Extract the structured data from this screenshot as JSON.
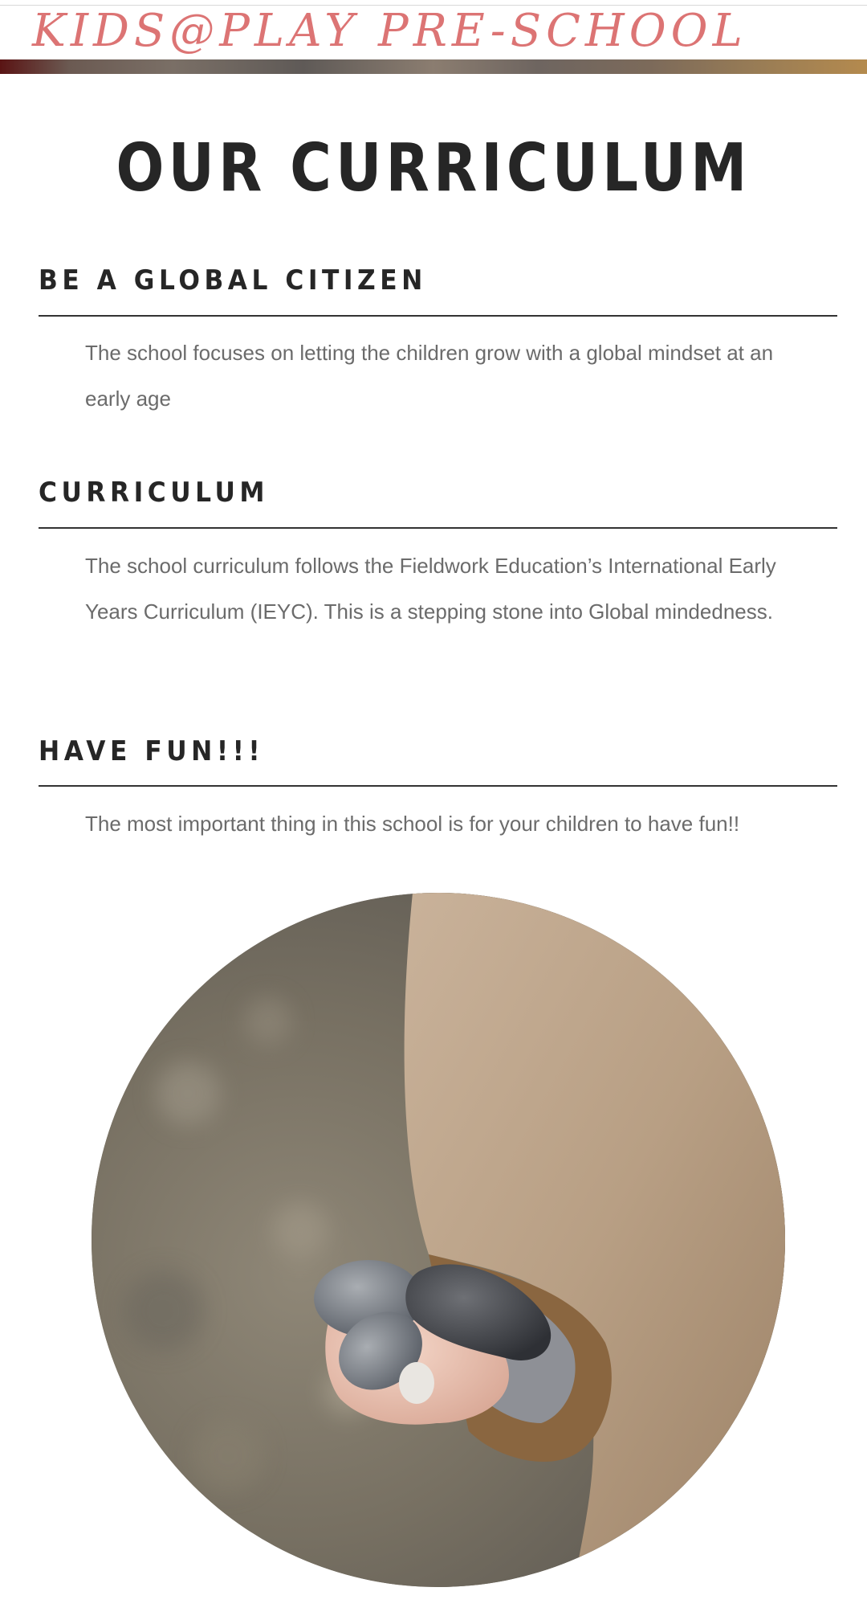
{
  "header": {
    "brand": "KIDS@PLAY PRE-SCHOOL"
  },
  "main": {
    "title": "OUR CURRICULUM",
    "sections": [
      {
        "heading": "BE A GLOBAL CITIZEN",
        "body": "The school focuses on letting the children grow with a global mindset at an early age"
      },
      {
        "heading": "CURRICULUM",
        "body": "The school curriculum follows the Fieldwork Education’s International Early Years Curriculum (IEYC). This is a stepping stone into Global mindedness."
      },
      {
        "heading": "HAVE FUN!!!",
        "body": "The most important thing in this school is for your children to have fun!!"
      }
    ],
    "photo": {
      "icon": "child-hand-holding-stones-photo"
    }
  },
  "colors": {
    "brand": "#dc7474",
    "heading": "#262626",
    "body_text": "#6b6b6b",
    "rule": "#333333"
  }
}
